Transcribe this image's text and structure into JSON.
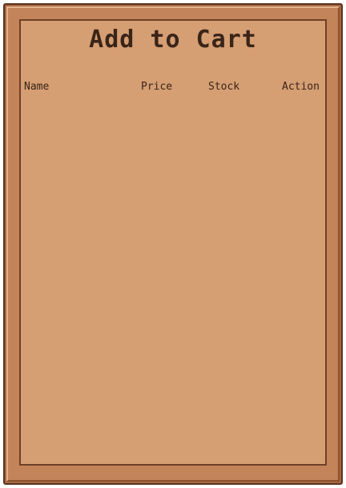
{
  "window": {
    "title": "Add to Cart"
  },
  "table": {
    "columns": [
      "Name",
      "Price",
      "Stock",
      "Action"
    ],
    "rows": []
  }
}
